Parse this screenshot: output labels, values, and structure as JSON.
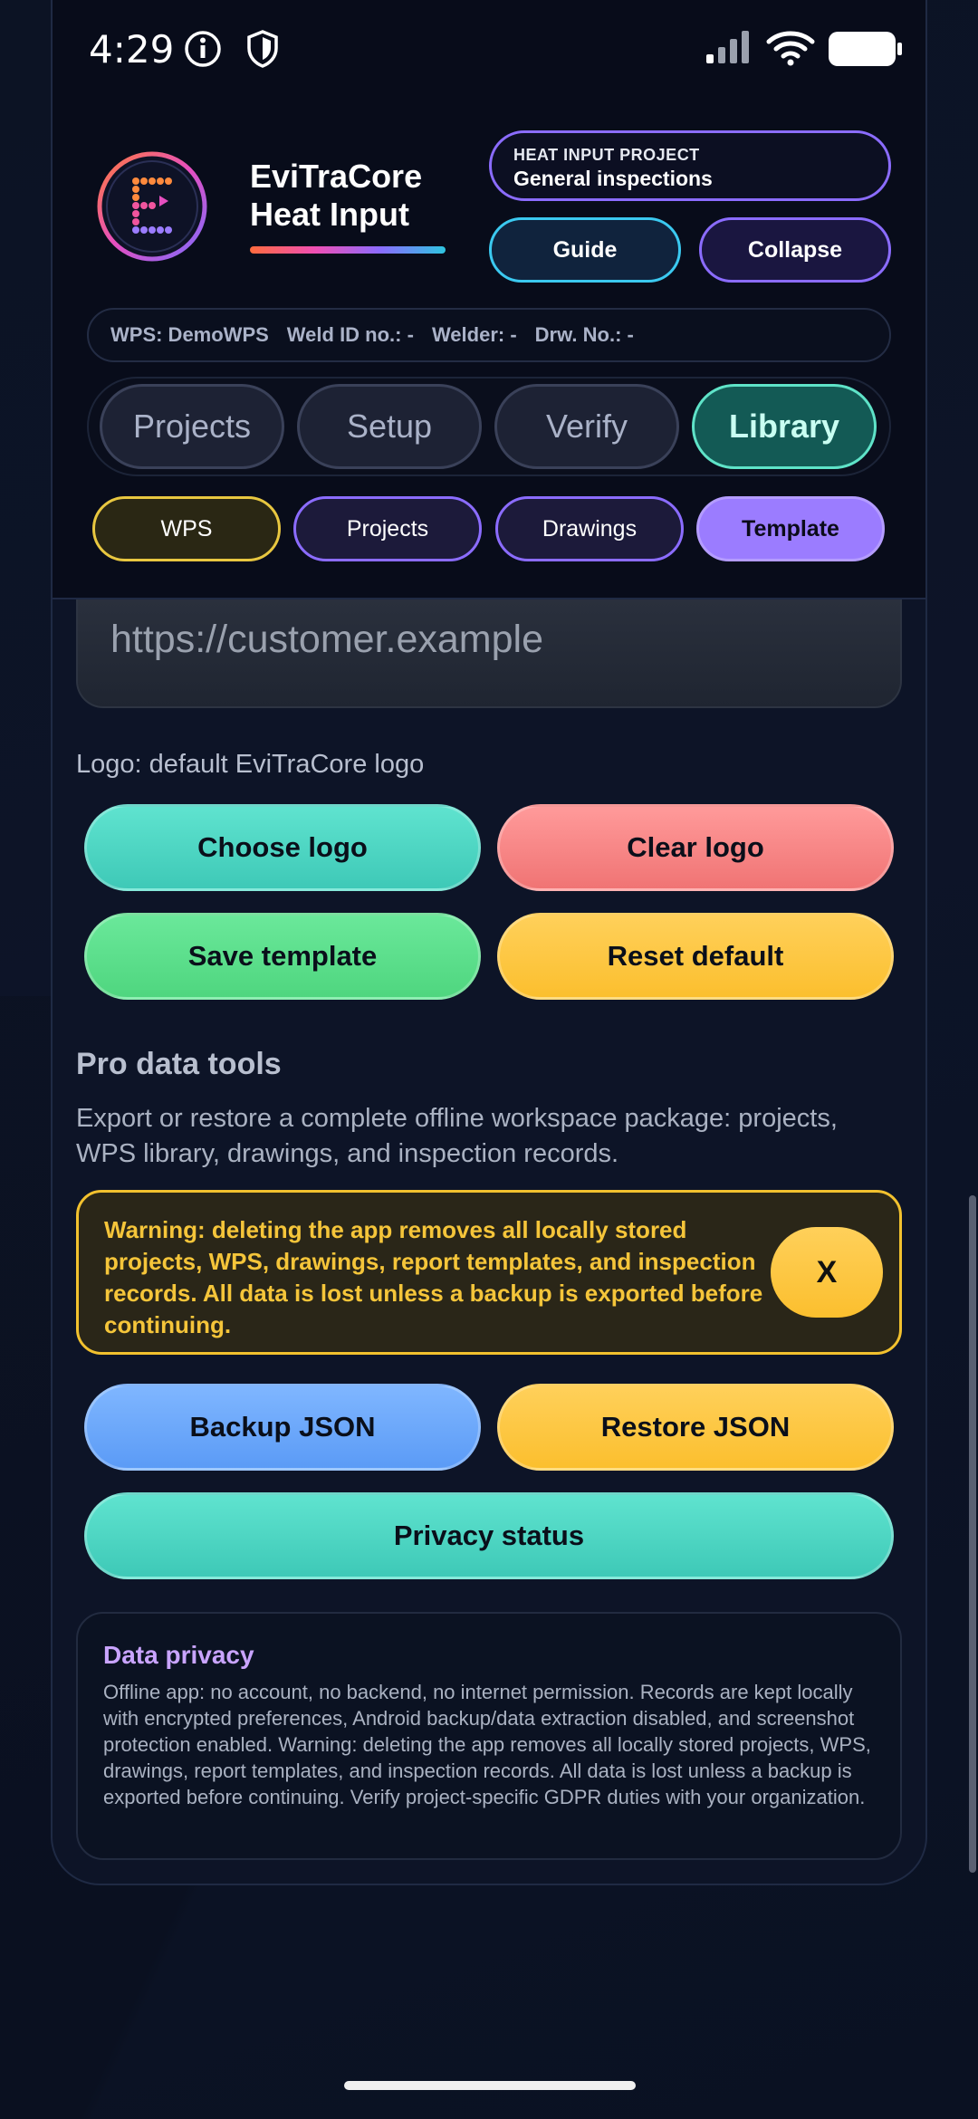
{
  "status_bar": {
    "time": "4:29",
    "icons": [
      "info-icon",
      "shield-icon",
      "signal-icon",
      "wifi-icon",
      "battery-icon"
    ]
  },
  "header": {
    "app_name_line1": "EviTraCore",
    "app_name_line2": "Heat Input",
    "project_label": "HEAT INPUT PROJECT",
    "project_value": "General inspections",
    "guide_label": "Guide",
    "collapse_label": "Collapse",
    "meta": {
      "wps": "WPS: DemoWPS",
      "weld_id": "Weld ID no.: -",
      "welder": "Welder: -",
      "drawing": "Drw. No.: -"
    }
  },
  "tabs": [
    {
      "label": "Projects",
      "active": false
    },
    {
      "label": "Setup",
      "active": false
    },
    {
      "label": "Verify",
      "active": false
    },
    {
      "label": "Library",
      "active": true
    }
  ],
  "subtabs": [
    {
      "label": "WPS",
      "active": false
    },
    {
      "label": "Projects",
      "active": false
    },
    {
      "label": "Drawings",
      "active": false
    },
    {
      "label": "Template",
      "active": true
    }
  ],
  "template": {
    "url_value": "https://customer.example",
    "logo_status": "Logo: default EviTraCore logo",
    "choose_logo": "Choose logo",
    "clear_logo": "Clear logo",
    "save_template": "Save template",
    "reset_default": "Reset default"
  },
  "pro_tools": {
    "title": "Pro data tools",
    "description": "Export or restore a complete offline workspace package: projects, WPS library, drawings, and inspection records.",
    "warning": "Warning: deleting the app removes all locally stored projects, WPS, drawings, report templates, and inspection records. All data is lost unless a backup is exported before continuing.",
    "dismiss": "X",
    "backup_json": "Backup JSON",
    "restore_json": "Restore JSON",
    "privacy_status": "Privacy status"
  },
  "privacy": {
    "title": "Data privacy",
    "body": "Offline app: no account, no backend, no internet permission. Records are kept locally with encrypted preferences, Android backup/data extraction disabled, and screenshot protection enabled. Warning: deleting the app removes all locally stored projects, WPS, drawings, report templates, and inspection records. All data is lost unless a backup is exported before continuing. Verify project-specific GDPR duties with your organization."
  },
  "colors": {
    "accent_teal": "#5fe3cf",
    "accent_purple": "#8b6cff",
    "warning_amber": "#f5c53a",
    "background": "#0b1020"
  }
}
